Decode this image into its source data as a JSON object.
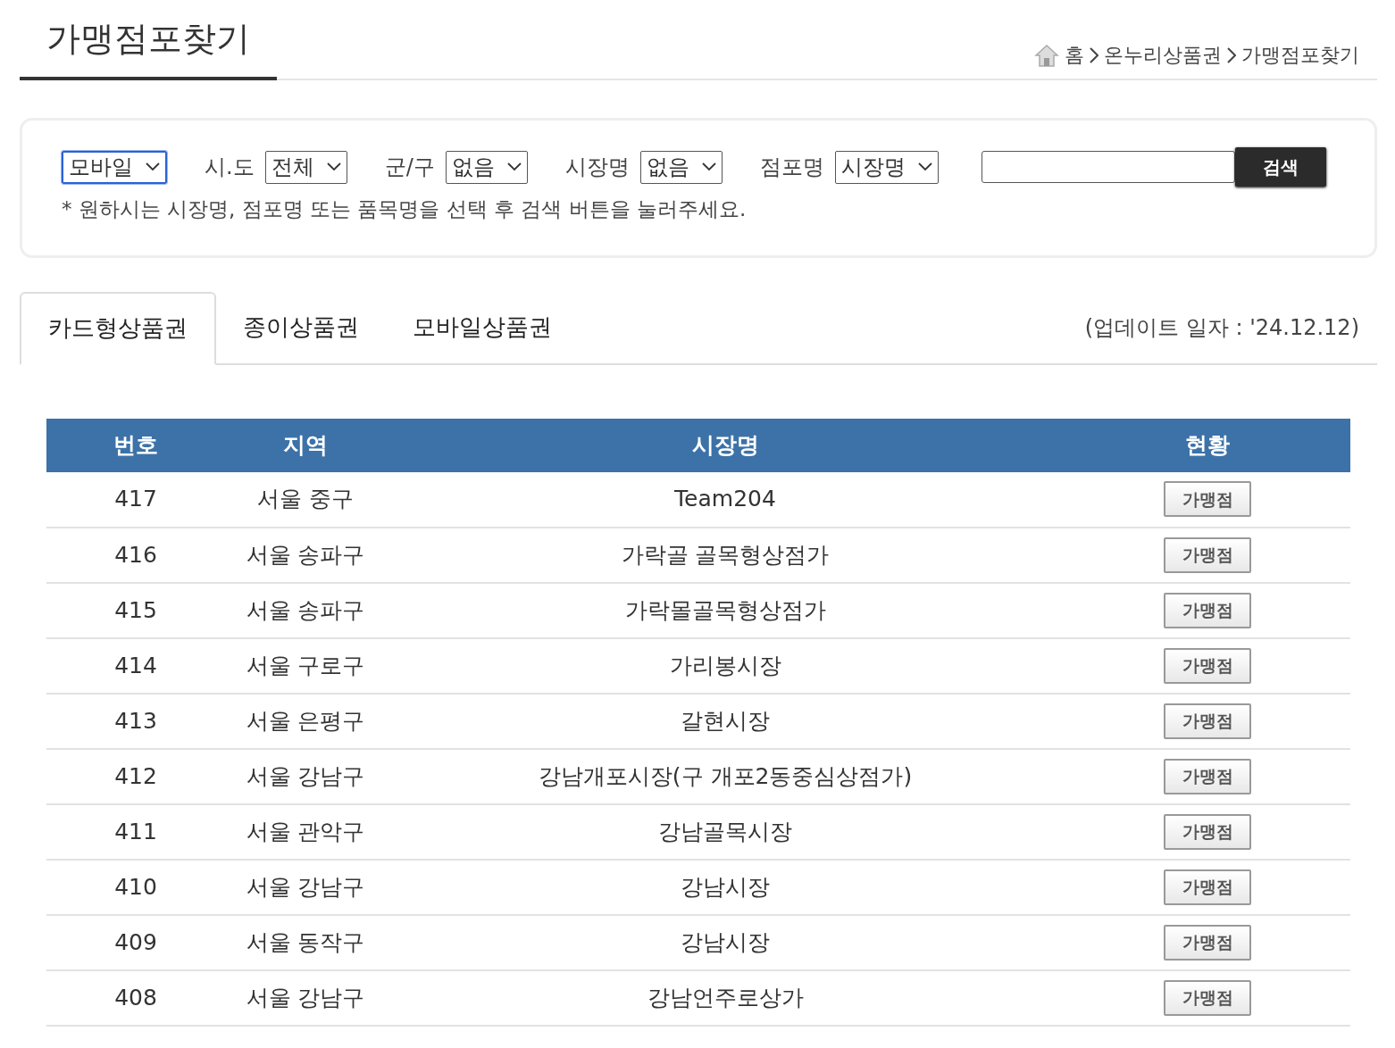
{
  "page_title": "가맹점포찾기",
  "breadcrumb": [
    "홈",
    "온누리상품권",
    "가맹점포찾기"
  ],
  "filters": [
    {
      "value": "모바일",
      "focused": true
    },
    {
      "label": "시.도",
      "value": "전체",
      "focused": false
    },
    {
      "label": "군/구",
      "value": "없음",
      "focused": false
    },
    {
      "label": "시장명",
      "value": "없음",
      "focused": false
    },
    {
      "label": "점포명",
      "value": "시장명",
      "focused": false
    }
  ],
  "search_button": "검색",
  "hint": "* 원하시는 시장명, 점포명 또는 품목명을 선택 후 검색 버튼을 눌러주세요.",
  "tabs": [
    {
      "label": "카드형상품권",
      "selected": true
    },
    {
      "label": "종이상품권",
      "selected": false
    },
    {
      "label": "모바일상품권",
      "selected": false
    }
  ],
  "update_date": "(업데이트 일자 : '24.12.12)",
  "table": {
    "columns": [
      "번호",
      "지역",
      "시장명",
      "현황"
    ],
    "rows": [
      [
        "417",
        "서울 중구",
        "Team204",
        "가맹점"
      ],
      [
        "416",
        "서울 송파구",
        "가락골 골목형상점가",
        "가맹점"
      ],
      [
        "415",
        "서울 송파구",
        "가락몰골목형상점가",
        "가맹점"
      ],
      [
        "414",
        "서울 구로구",
        "가리봉시장",
        "가맹점"
      ],
      [
        "413",
        "서울 은평구",
        "갈현시장",
        "가맹점"
      ],
      [
        "412",
        "서울 강남구",
        "강남개포시장(구 개포2동중심상점가)",
        "가맹점"
      ],
      [
        "411",
        "서울 관악구",
        "강남골목시장",
        "가맹점"
      ],
      [
        "410",
        "서울 강남구",
        "강남시장",
        "가맹점"
      ],
      [
        "409",
        "서울 동작구",
        "강남시장",
        "가맹점"
      ],
      [
        "408",
        "서울 강남구",
        "강남언주로상가",
        "가맹점"
      ]
    ]
  }
}
